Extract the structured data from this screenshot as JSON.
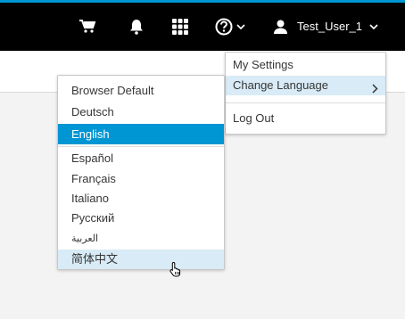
{
  "header": {
    "icons": [
      "cart-icon",
      "bell-icon",
      "apps-grid-icon",
      "help-icon",
      "user-icon"
    ],
    "user_name": "Test_User_1"
  },
  "user_menu": {
    "items": [
      "My Settings",
      "Change Language",
      "Log Out"
    ],
    "hovered": "Change Language"
  },
  "language_menu": {
    "items": [
      "Browser Default",
      "Deutsch",
      "English",
      "Español",
      "Français",
      "Italiano",
      "Русский",
      "العربية",
      "简体中文"
    ],
    "selected": "English",
    "hovered": "简体中文"
  },
  "colors": {
    "topbar": "#000000",
    "accent": "#0095d3",
    "hover": "#d8ebf6"
  }
}
